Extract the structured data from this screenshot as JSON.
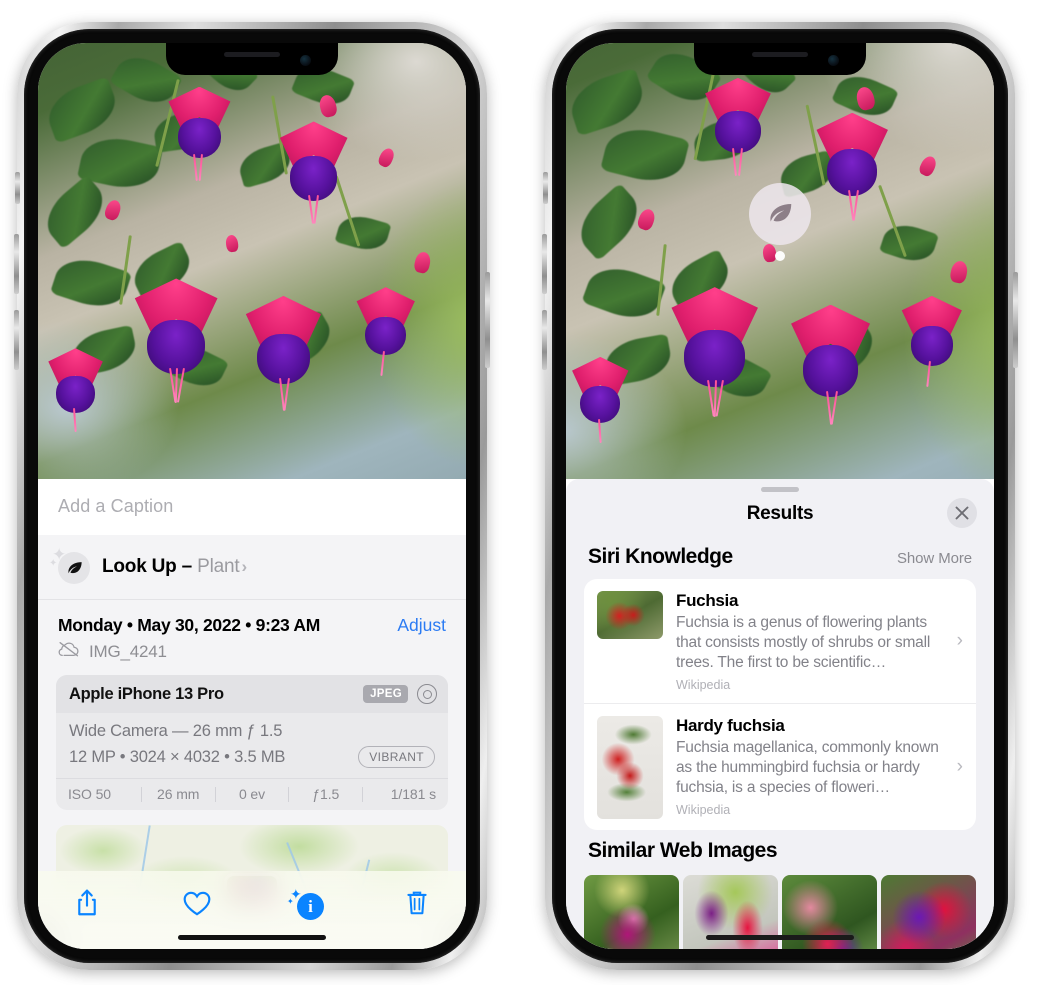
{
  "left_phone": {
    "photo_alt": "fuchsia-flowers-photo",
    "caption_placeholder": "Add a Caption",
    "lookup": {
      "icon": "leaf-icon",
      "sparkle_icon": "sparkle-icon",
      "label": "Look Up – ",
      "subject": "Plant",
      "chevron": "›"
    },
    "date_line": "Monday • May 30, 2022 • 9:23 AM",
    "adjust_label": "Adjust",
    "cloud_icon": "cloud-slash-icon",
    "file_name": "IMG_4241",
    "exif": {
      "device": "Apple iPhone 13 Pro",
      "format_chip": "JPEG",
      "aperture_icon": "aperture-icon",
      "lens_line": "Wide Camera — 26 mm ƒ 1.5",
      "size_line": "12 MP • 3024 × 4032 • 3.5 MB",
      "style_chip": "VIBRANT",
      "stats": [
        "ISO 50",
        "26 mm",
        "0 ev",
        "ƒ1.5",
        "1/181 s"
      ]
    },
    "map": {
      "pin_label": "photo-location-pin"
    },
    "toolbar": {
      "share_icon": "share-icon",
      "favorite_icon": "heart-icon",
      "info_icon": "info-sparkle-icon",
      "delete_icon": "trash-icon",
      "accent_color": "#0a84ff"
    }
  },
  "right_phone": {
    "photo_alt": "fuchsia-flowers-photo-blurred",
    "badge_icon": "leaf-icon",
    "sheet": {
      "grabber": "sheet-grabber",
      "title": "Results",
      "close_icon": "close-icon"
    },
    "siri_knowledge": {
      "title": "Siri Knowledge",
      "action": "Show More",
      "items": [
        {
          "title": "Fuchsia",
          "description": "Fuchsia is a genus of flowering plants that consists mostly of shrubs or small trees. The first to be scientific…",
          "source": "Wikipedia",
          "thumb": "fuchsia-red-flowers-thumb"
        },
        {
          "title": "Hardy fuchsia",
          "description": "Fuchsia magellanica, commonly known as the hummingbird fuchsia or hardy fuchsia, is a species of floweri…",
          "source": "Wikipedia",
          "thumb": "hardy-fuchsia-specimen-thumb"
        }
      ]
    },
    "similar_web_images": {
      "title": "Similar Web Images",
      "images": [
        "fuchsia-pink-white-bloom",
        "fuchsia-red-magenta-closeup",
        "fuchsia-bush-garden",
        "fuchsia-purple-red-cluster"
      ]
    }
  }
}
